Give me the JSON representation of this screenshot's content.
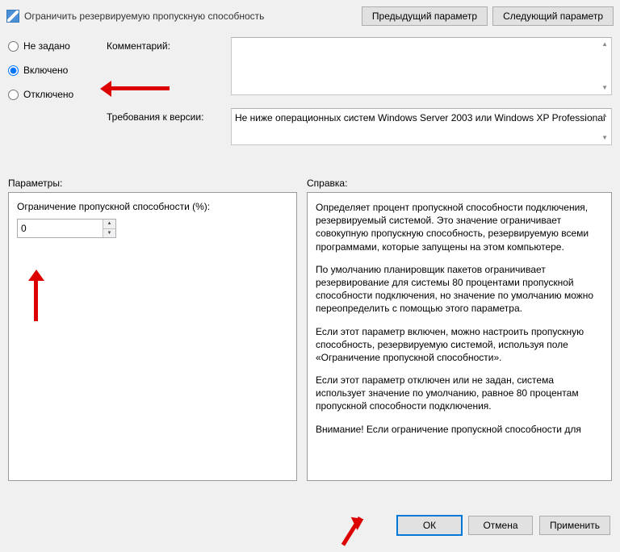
{
  "title": "Ограничить резервируемую пропускную способность",
  "nav": {
    "prev": "Предыдущий параметр",
    "next": "Следующий параметр"
  },
  "state": {
    "not_configured": "Не задано",
    "enabled": "Включено",
    "disabled": "Отключено",
    "selected": "enabled"
  },
  "fields": {
    "comment_label": "Комментарий:",
    "comment_value": "",
    "req_label": "Требования к версии:",
    "req_value": "Не ниже операционных систем Windows Server 2003 или Windows XP Professional"
  },
  "params_label": "Параметры:",
  "help_label": "Справка:",
  "bandwidth": {
    "label": "Ограничение пропускной способности (%):",
    "value": "0"
  },
  "help_text": {
    "p1": "Определяет процент пропускной способности подключения, резервируемый системой. Это значение ограничивает совокупную пропускную способность, резервируемую всеми программами, которые запущены на этом компьютере.",
    "p2": "По умолчанию планировщик пакетов ограничивает резервирование для системы 80 процентами пропускной способности подключения, но значение по умолчанию можно переопределить с помощью этого параметра.",
    "p3": "Если этот параметр включен, можно настроить пропускную способность, резервируемую системой, используя поле «Ограничение пропускной способности».",
    "p4": "Если этот параметр отключен или не задан, система использует значение по умолчанию, равное 80 процентам пропускной способности подключения.",
    "p5": "Внимание! Если ограничение пропускной способности для"
  },
  "buttons": {
    "ok": "ОК",
    "cancel": "Отмена",
    "apply": "Применить"
  }
}
